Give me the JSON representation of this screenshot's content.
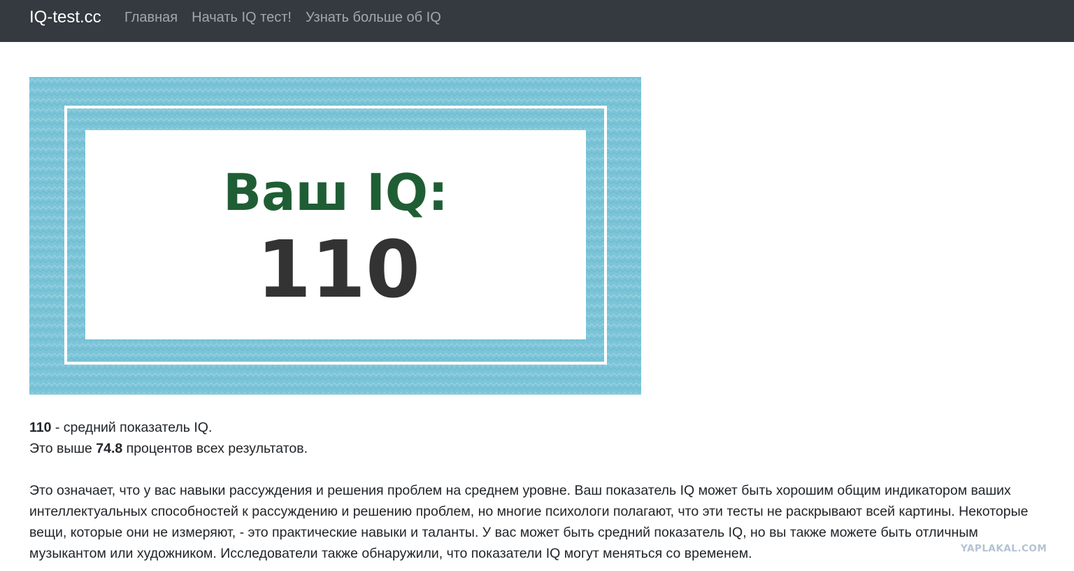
{
  "nav": {
    "brand": "IQ-test.cc",
    "links": [
      "Главная",
      "Начать IQ тест!",
      "Узнать больше об IQ"
    ]
  },
  "banner": {
    "heading": "Ваш IQ:",
    "score": "110"
  },
  "result": {
    "score": "110",
    "score_suffix": " - средний показатель IQ.",
    "line2_prefix": "Это выше ",
    "percentile": "74.8",
    "line2_suffix": " процентов всех результатов.",
    "paragraph": "Это означает, что у вас навыки рассуждения и решения проблем на среднем уровне. Ваш показатель IQ может быть хорошим общим индикатором ваших интеллектуальных способностей к рассуждению и решению проблем, но многие психологи полагают, что эти тесты не раскрывают всей картины. Некоторые вещи, которые они не измеряют, - это практические навыки и таланты. У вас может быть средний показатель IQ, но вы также можете быть отличным музыкантом или художником. Исследователи также обнаружили, что показатели IQ могут меняться со временем."
  },
  "watermark": "YAPLAKAL.COM",
  "colors": {
    "navbar": "#343a40",
    "banner_blue": "#7cc4d8",
    "heading_green": "#1f5e34",
    "score_dark": "#333333"
  }
}
